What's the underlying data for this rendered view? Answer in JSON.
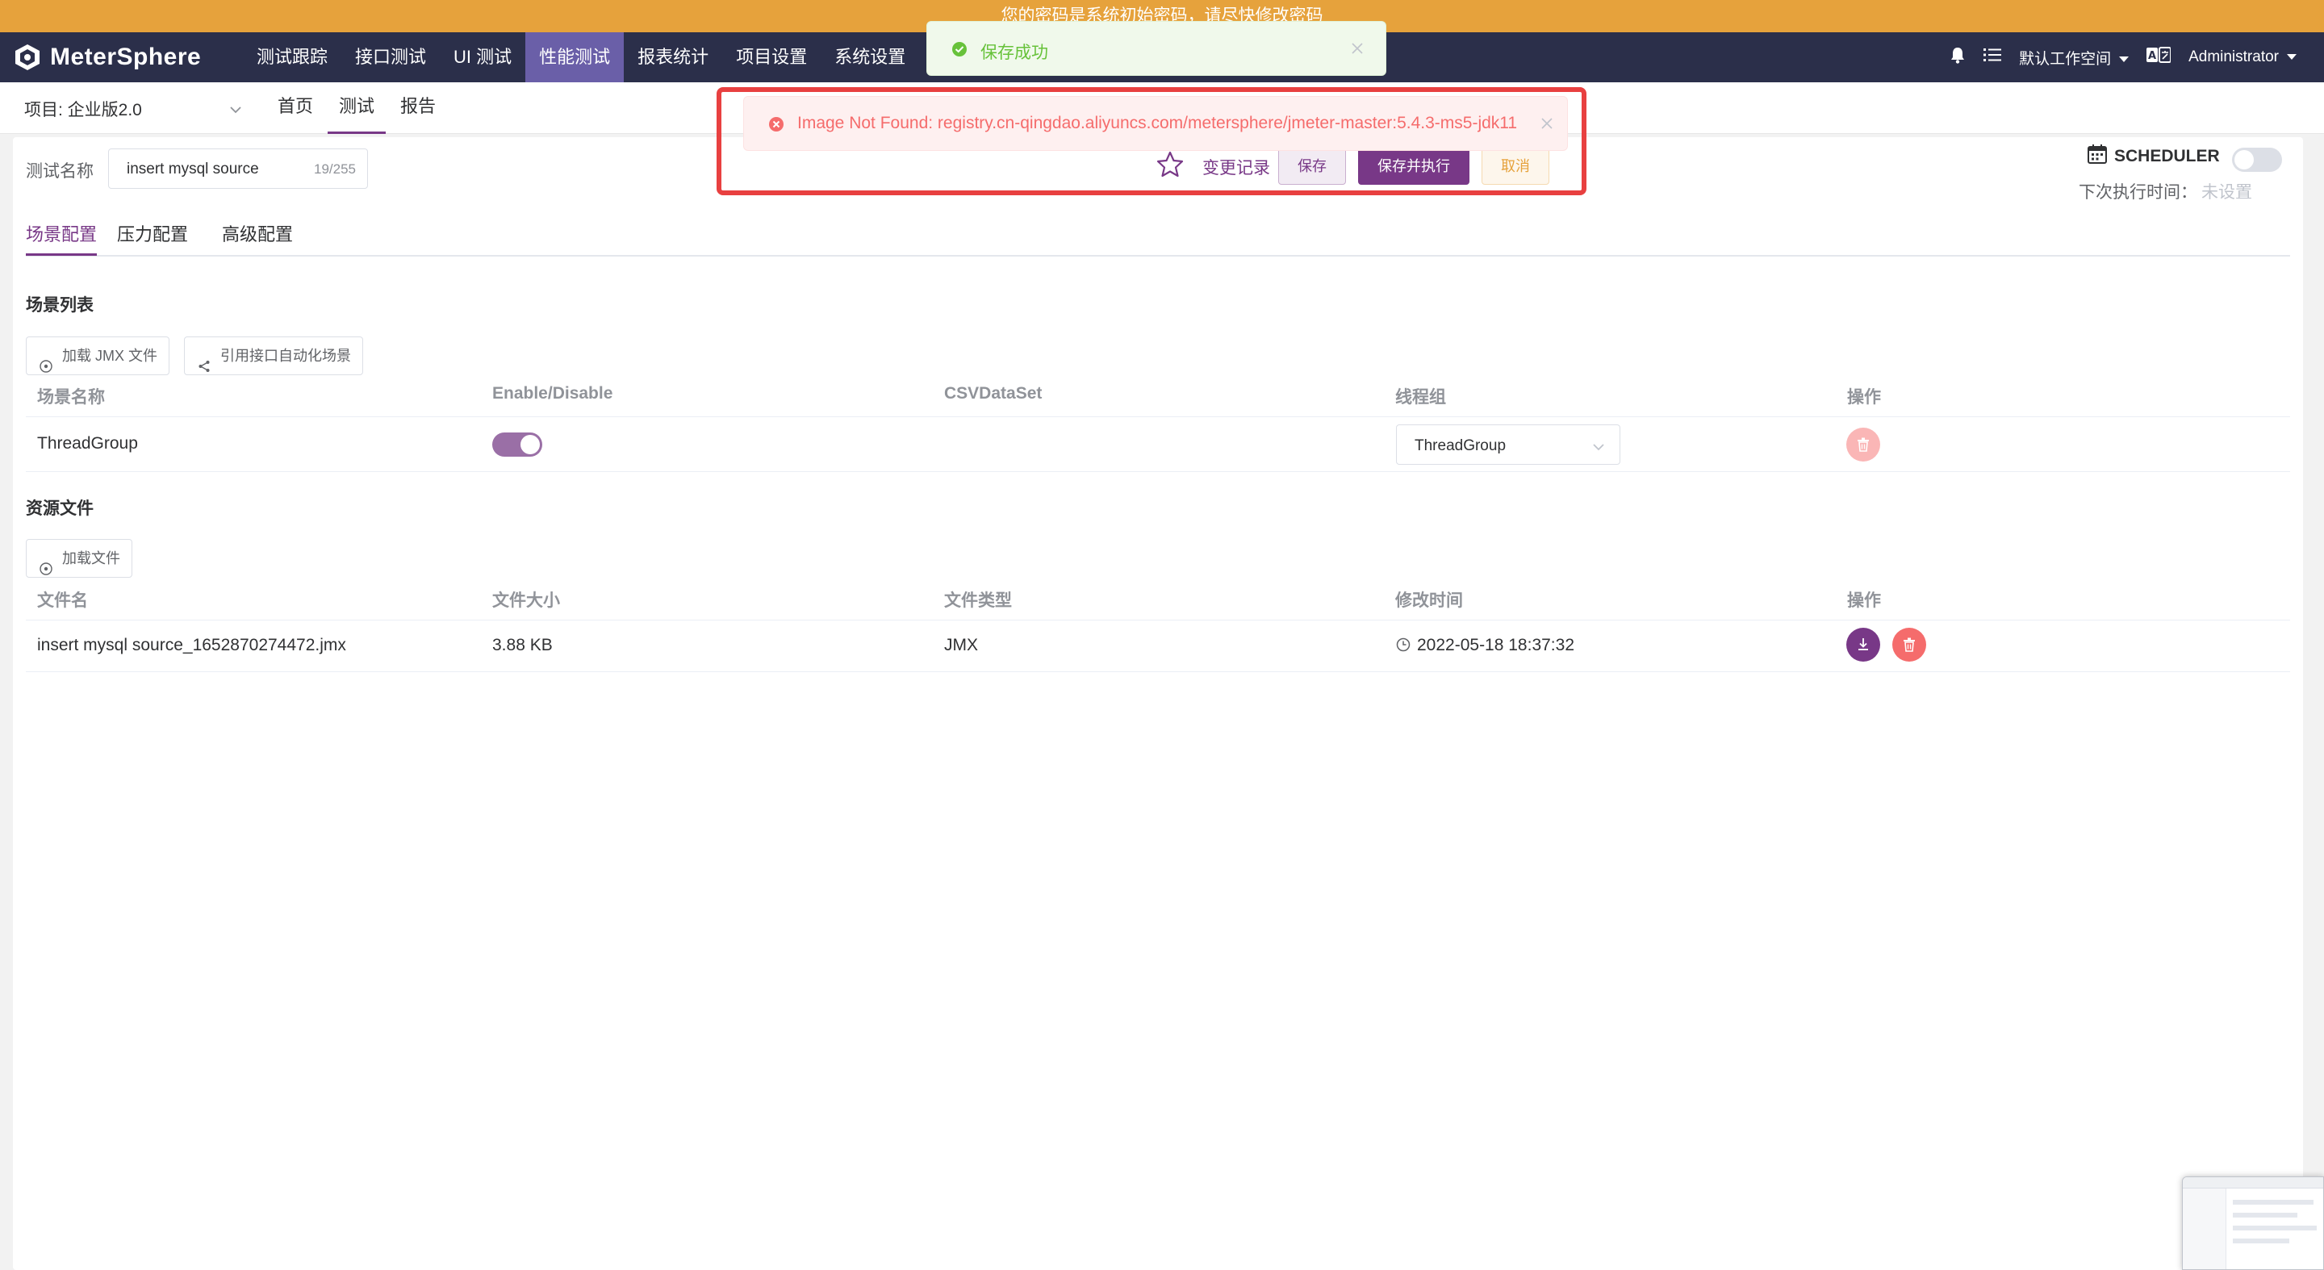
{
  "banner": {
    "text": "您的密码是系统初始密码，请尽快修改密码"
  },
  "nav": {
    "logo": "MeterSphere",
    "menu": [
      "测试跟踪",
      "接口测试",
      "UI 测试",
      "性能测试",
      "报表统计",
      "项目设置",
      "系统设置"
    ],
    "active_menu": "性能测试",
    "workspace": "默认工作空间",
    "user": "Administrator"
  },
  "subnav": {
    "project": "项目: 企业版2.0",
    "tabs": [
      "首页",
      "测试",
      "报告"
    ],
    "active_tab": "测试"
  },
  "form": {
    "name_label": "测试名称",
    "name_value": "insert mysql source",
    "name_counter": "19/255",
    "change_log": "变更记录",
    "save": "保存",
    "save_run": "保存并执行",
    "cancel": "取消",
    "scheduler": "SCHEDULER",
    "next_run_label": "下次执行时间：",
    "next_run_value": "未设置"
  },
  "config_tabs": [
    "场景配置",
    "压力配置",
    "高级配置"
  ],
  "scenes": {
    "title": "场景列表",
    "load_jmx": "加载 JMX 文件",
    "ref_api": "引用接口自动化场景",
    "headers": [
      "场景名称",
      "Enable/Disable",
      "CSVDataSet",
      "线程组",
      "操作"
    ],
    "rows": [
      {
        "name": "ThreadGroup",
        "enabled": true,
        "csv": "",
        "thread_group": "ThreadGroup"
      }
    ]
  },
  "files": {
    "title": "资源文件",
    "load_file": "加载文件",
    "headers": [
      "文件名",
      "文件大小",
      "文件类型",
      "修改时间",
      "操作"
    ],
    "rows": [
      {
        "name": "insert mysql source_1652870274472.jmx",
        "size": "3.88 KB",
        "type": "JMX",
        "modified": "2022-05-18 18:37:32"
      }
    ]
  },
  "toasts": {
    "success": "保存成功",
    "error": "Image Not Found: registry.cn-qingdao.aliyuncs.com/metersphere/jmeter-master:5.4.3-ms5-jdk11"
  },
  "colors": {
    "brand": "#783887",
    "nav_bg": "#2b2f4a",
    "banner": "#e6a23c",
    "success": "#67c23a",
    "error": "#f56c6c",
    "highlight": "#e84040"
  }
}
